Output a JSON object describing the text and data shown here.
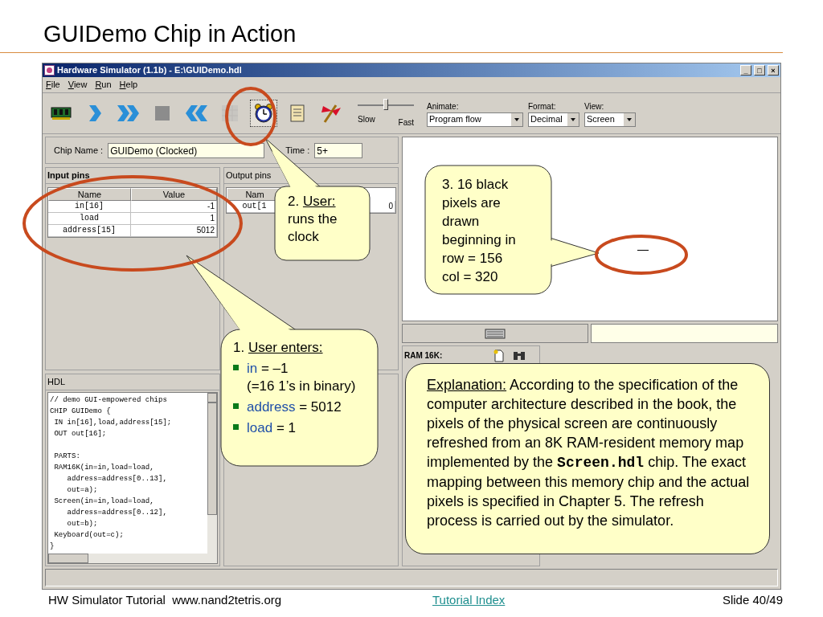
{
  "slide": {
    "title": "GUIDemo Chip in Action"
  },
  "window": {
    "title": "Hardware Simulator (1.1b) - E:\\GUIDemo.hdl",
    "controls": [
      "_",
      "□",
      "×"
    ]
  },
  "menu": [
    "File",
    "View",
    "Run",
    "Help"
  ],
  "toolbar": [
    {
      "kind": "chip",
      "selected": false,
      "disabled": false
    },
    {
      "kind": "step",
      "selected": false,
      "disabled": false
    },
    {
      "kind": "run",
      "selected": false,
      "disabled": false
    },
    {
      "kind": "stop",
      "selected": false,
      "disabled": false
    },
    {
      "kind": "reset",
      "selected": false,
      "disabled": false
    },
    {
      "kind": "grid",
      "selected": false,
      "disabled": true
    },
    {
      "kind": "clock",
      "selected": true,
      "disabled": false
    },
    {
      "kind": "script",
      "selected": false,
      "disabled": false
    },
    {
      "kind": "flag",
      "selected": false,
      "disabled": false
    }
  ],
  "speed": {
    "level": 0.5,
    "min_label": "Slow",
    "max_label": "Fast"
  },
  "dropdowns": [
    {
      "label": "Animate:",
      "value": "Program flow"
    },
    {
      "label": "Format:",
      "value": "Decimal"
    },
    {
      "label": "View:",
      "value": "Screen"
    }
  ],
  "chip_name": {
    "label": "Chip Name :",
    "value": "GUIDemo (Clocked)"
  },
  "time": {
    "label": "Time :",
    "value": "5+"
  },
  "input_pins": {
    "title": "Input pins",
    "columns": [
      "Name",
      "Value"
    ],
    "rows": [
      [
        "in[16]",
        "-1"
      ],
      [
        "load",
        "1"
      ],
      [
        "address[15]",
        "5012"
      ]
    ]
  },
  "output_pins": {
    "title": "Output pins",
    "columns": [
      "Nam"
    ],
    "rows": [
      [
        "out[1",
        "0"
      ]
    ]
  },
  "hdl": {
    "title": "HDL",
    "blocks": [
      [
        "// demo GUI-empowered chips",
        "CHIP GUIDemo {",
        " IN in[16],load,address[15];",
        " OUT out[16];"
      ],
      [
        " PARTS:",
        " RAM16K(in=in,load=load,",
        "    address=address[0..13],",
        "    out=a);",
        " Screen(in=in,load=load,",
        "    address=address[0..12],",
        "    out=b);",
        " Keyboard(out=c);",
        "}"
      ]
    ]
  },
  "ram": {
    "title": "RAM 16K:"
  },
  "callouts": {
    "user_enters": {
      "number": "1.",
      "heading": "User enters:",
      "bullets": [
        {
          "term": "in",
          "text": "= –1",
          "note": "(=16 1’s in binary)"
        },
        {
          "term": "address",
          "text": "= 5012"
        },
        {
          "term": "load",
          "text": "= 1"
        }
      ]
    },
    "runs_clock": {
      "number": "2.",
      "heading": "User:",
      "text": "runs the clock"
    },
    "pixels": {
      "lines": [
        "3. 16 black",
        "pixels are",
        "drawn",
        "beginning in",
        "row = 156",
        "col = 320"
      ]
    },
    "explanation": {
      "heading": "Explanation:",
      "before": "According to the specification of the computer architecture described in the book, the pixels of the physical screen are continuously refreshed from an 8K RAM-resident memory map implemented by the",
      "code": "Screen.hdl",
      "after": "chip. The exact mapping between this memory chip and the actual pixels is specified in Chapter 5. The refresh process is carried out by the simulator."
    }
  },
  "footer": {
    "left": "HW Simulator Tutorial  www.nand2tetris.org",
    "link": "Tutorial Index",
    "right": "Slide 40/49"
  }
}
